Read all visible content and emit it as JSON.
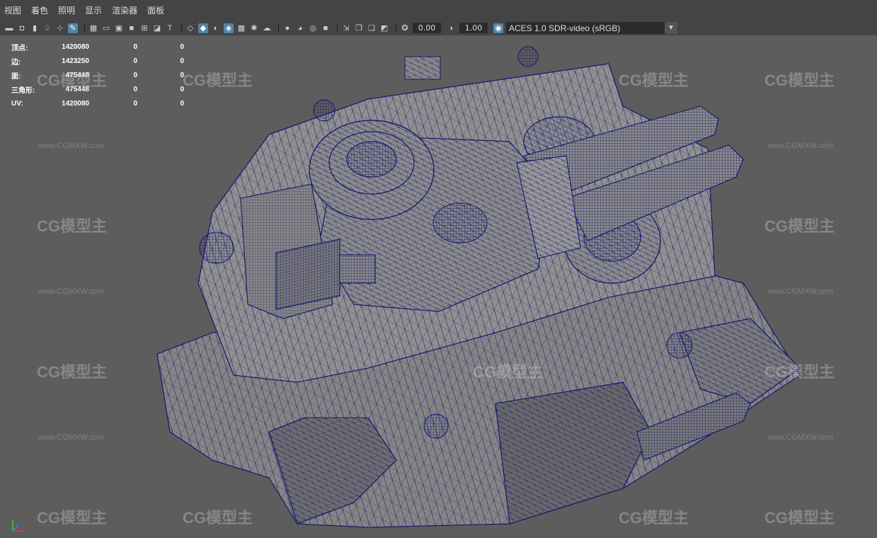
{
  "menu": [
    "视图",
    "着色",
    "照明",
    "显示",
    "渲染器",
    "面板"
  ],
  "toolbar": {
    "exposure": "0.00",
    "gamma": "1.00",
    "color_space": "ACES 1.0 SDR-video (sRGB)"
  },
  "hud": {
    "rows": [
      {
        "label": "顶点:",
        "total": "1420080",
        "selected": "0",
        "tri": "0"
      },
      {
        "label": "边:",
        "total": "1423250",
        "selected": "0",
        "tri": "0"
      },
      {
        "label": "面:",
        "total": "475448",
        "selected": "0",
        "tri": "0"
      },
      {
        "label": "三角形:",
        "total": "475448",
        "selected": "0",
        "tri": "0"
      },
      {
        "label": "UV:",
        "total": "1420080",
        "selected": "0",
        "tri": "0"
      }
    ]
  },
  "watermark": {
    "logo": "CG模型主",
    "url": "www.CGMXW.com"
  },
  "colors": {
    "wire": "#1a1a6e",
    "mesh": "#8a8a8a",
    "bg": "#5d5d5d",
    "accent": "#5285a6"
  }
}
